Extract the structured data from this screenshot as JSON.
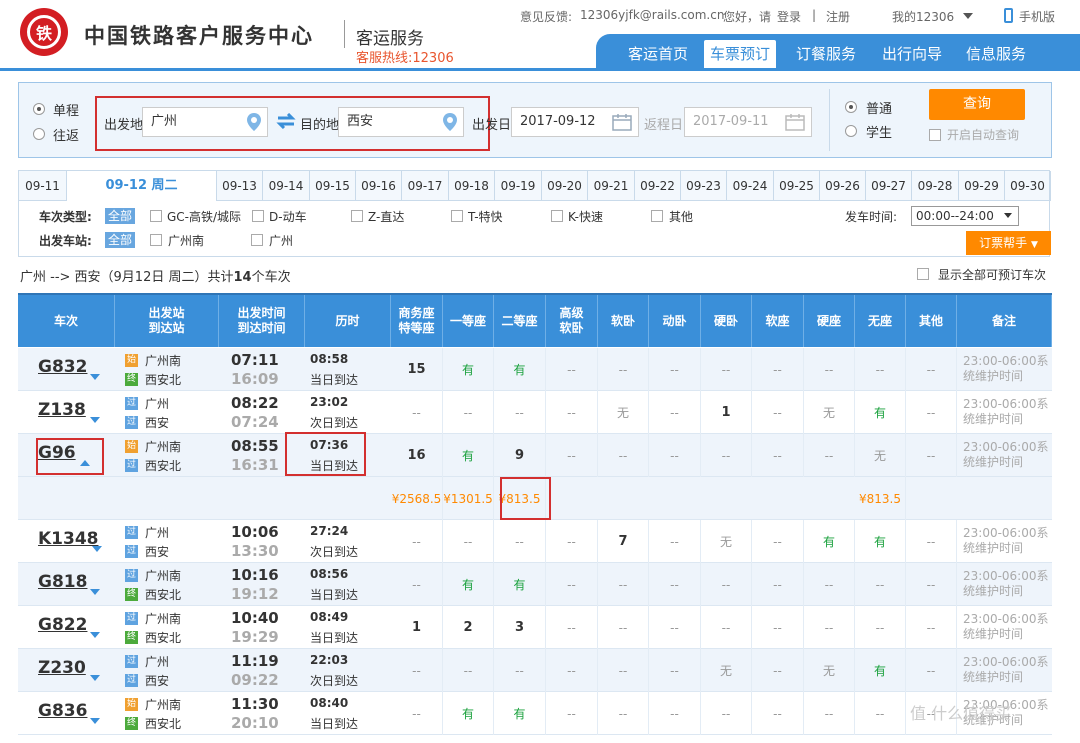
{
  "header": {
    "logo_text": "铁",
    "site_title": "中国铁路客户服务中心",
    "sub_title": "客运服务",
    "hotline": "客服热线:12306",
    "feedback_label": "意见反馈:",
    "feedback_email": "12306yjfk@rails.com.cn",
    "greeting": "您好，请",
    "login": "登录",
    "sep": "|",
    "register": "注册",
    "my12306": "我的12306",
    "mobile": "手机版"
  },
  "nav": [
    "客运首页",
    "车票预订",
    "订餐服务",
    "出行向导",
    "信息服务"
  ],
  "search": {
    "oneway": "单程",
    "roundtrip": "往返",
    "from_label": "出发地",
    "from_value": "广州",
    "to_label": "目的地",
    "to_value": "西安",
    "date_label": "出发日",
    "date_value": "2017-09-12",
    "return_label": "返程日",
    "return_value": "2017-09-11",
    "normal": "普通",
    "student": "学生",
    "query_button": "查询",
    "auto_query": "开启自动查询"
  },
  "dates": [
    "09-11",
    "09-12 周二",
    "09-13",
    "09-14",
    "09-15",
    "09-16",
    "09-17",
    "09-18",
    "09-19",
    "09-20",
    "09-21",
    "09-22",
    "09-23",
    "09-24",
    "09-25",
    "09-26",
    "09-27",
    "09-28",
    "09-29",
    "09-30"
  ],
  "filters": {
    "type_label": "车次类型:",
    "all": "全部",
    "types": [
      "GC-高铁/城际",
      "D-动车",
      "Z-直达",
      "T-特快",
      "K-快速",
      "其他"
    ],
    "station_label": "出发车站:",
    "stations": [
      "广州南",
      "广州"
    ],
    "depart_time_label": "发车时间:",
    "depart_time_value": "00:00--24:00",
    "help_button": "订票帮手"
  },
  "summary": {
    "route": "广州 --> 西安（9月12日  周二）共计",
    "count": "14",
    "suffix": "个车次",
    "show_all": "显示全部可预订车次"
  },
  "columns": [
    "车次",
    "出发站\n到达站",
    "出发时间\n到达时间",
    "历时",
    "商务座\n特等座",
    "一等座",
    "二等座",
    "高级\n软卧",
    "软卧",
    "动卧",
    "硬卧",
    "软座",
    "硬座",
    "无座",
    "其他",
    "备注"
  ],
  "trains": [
    {
      "no": "G832",
      "from": "广州南",
      "to": "西安北",
      "fb": "始",
      "tb": "终",
      "dep": "07:11",
      "arr": "16:09",
      "dur": "08:58",
      "arrday": "当日到达",
      "seats": [
        "15",
        "有",
        "有",
        "--",
        "--",
        "--",
        "--",
        "--",
        "--",
        "--",
        "--"
      ],
      "note": "23:00-06:00系统维护时间"
    },
    {
      "no": "Z138",
      "from": "广州",
      "to": "西安",
      "fb": "过",
      "tb": "过",
      "dep": "08:22",
      "arr": "07:24",
      "dur": "23:02",
      "arrday": "次日到达",
      "seats": [
        "--",
        "--",
        "--",
        "--",
        "无",
        "--",
        "1",
        "--",
        "无",
        "有",
        "--"
      ],
      "note": "23:00-06:00系统维护时间"
    },
    {
      "no": "G96",
      "from": "广州南",
      "to": "西安北",
      "fb": "始",
      "tb": "过",
      "dep": "08:55",
      "arr": "16:31",
      "dur": "07:36",
      "arrday": "当日到达",
      "seats": [
        "16",
        "有",
        "9",
        "--",
        "--",
        "--",
        "--",
        "--",
        "--",
        "无",
        "--"
      ],
      "note": "23:00-06:00系统维护时间"
    },
    {
      "no": "K1348",
      "from": "广州",
      "to": "西安",
      "fb": "过",
      "tb": "过",
      "dep": "10:06",
      "arr": "13:30",
      "dur": "27:24",
      "arrday": "次日到达",
      "seats": [
        "--",
        "--",
        "--",
        "--",
        "7",
        "--",
        "无",
        "--",
        "有",
        "有",
        "--"
      ],
      "note": "23:00-06:00系统维护时间"
    },
    {
      "no": "G818",
      "from": "广州南",
      "to": "西安北",
      "fb": "过",
      "tb": "终",
      "dep": "10:16",
      "arr": "19:12",
      "dur": "08:56",
      "arrday": "当日到达",
      "seats": [
        "--",
        "有",
        "有",
        "--",
        "--",
        "--",
        "--",
        "--",
        "--",
        "--",
        "--"
      ],
      "note": "23:00-06:00系统维护时间"
    },
    {
      "no": "G822",
      "from": "广州南",
      "to": "西安北",
      "fb": "过",
      "tb": "终",
      "dep": "10:40",
      "arr": "19:29",
      "dur": "08:49",
      "arrday": "当日到达",
      "seats": [
        "1",
        "2",
        "3",
        "--",
        "--",
        "--",
        "--",
        "--",
        "--",
        "--",
        "--"
      ],
      "note": "23:00-06:00系统维护时间"
    },
    {
      "no": "Z230",
      "from": "广州",
      "to": "西安",
      "fb": "过",
      "tb": "过",
      "dep": "11:19",
      "arr": "09:22",
      "dur": "22:03",
      "arrday": "次日到达",
      "seats": [
        "--",
        "--",
        "--",
        "--",
        "--",
        "--",
        "无",
        "--",
        "无",
        "有",
        "--"
      ],
      "note": "23:00-06:00系统维护时间"
    },
    {
      "no": "G836",
      "from": "广州南",
      "to": "西安北",
      "fb": "始",
      "tb": "终",
      "dep": "11:30",
      "arr": "20:10",
      "dur": "08:40",
      "arrday": "当日到达",
      "seats": [
        "--",
        "有",
        "有",
        "--",
        "--",
        "--",
        "--",
        "--",
        "--",
        "--",
        "--"
      ],
      "note": "23:00-06:00系统维护时间"
    }
  ],
  "g96_prices": {
    "business": "¥2568.5",
    "first": "¥1301.5",
    "second": "¥813.5",
    "noseat": "¥813.5"
  },
  "watermark": "值 什么值得买"
}
